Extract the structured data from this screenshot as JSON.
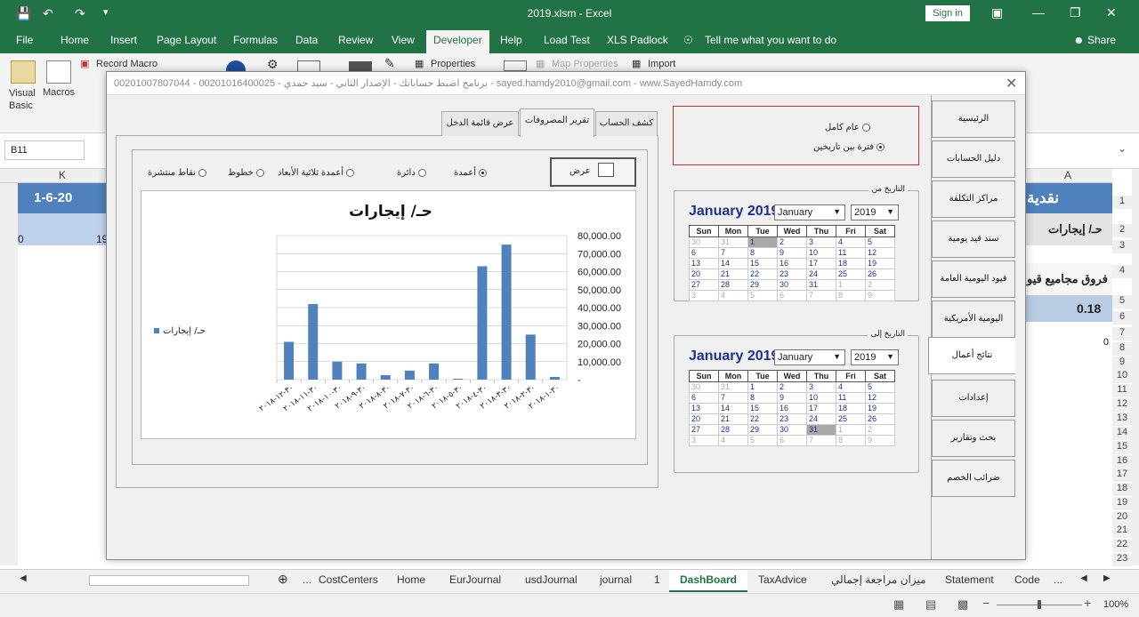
{
  "window": {
    "title": "2019.xlsm  -  Excel",
    "sign_in": "Sign in"
  },
  "ribbon_tabs": [
    "File",
    "Home",
    "Insert",
    "Page Layout",
    "Formulas",
    "Data",
    "Review",
    "View",
    "Developer",
    "Help",
    "Load Test",
    "XLS Padlock",
    "Tell me what you want to do",
    "Share"
  ],
  "ribbon": {
    "visual_basic": "Visual Basic",
    "macros": "Macros",
    "record_macro": "Record Macro",
    "properties": "Properties",
    "map_properties": "Map Properties",
    "import": "Import"
  },
  "namebox": "B11",
  "sheet": {
    "col_k": "K",
    "col_a": "A",
    "k_row1": "1-6-20",
    "k_row2": "19",
    "left_row2": "0",
    "a_row1": "نقدية",
    "a_row2": "حـ/ إيجارات",
    "a_row4": "فروق مجاميع قيو",
    "a_row5": "0.18",
    "a_row7": "0",
    "rows": [
      "1",
      "2",
      "3",
      "4",
      "5",
      "6",
      "7",
      "8",
      "9",
      "10",
      "11",
      "12",
      "13",
      "14",
      "15",
      "16",
      "17",
      "18",
      "19",
      "20",
      "21",
      "22",
      "23"
    ]
  },
  "sheet_tabs": [
    "...",
    "CostCenters",
    "Home",
    "EurJournal",
    "usdJournal",
    "journal",
    "1",
    "DashBoard",
    "TaxAdvice",
    "ميزان مراجعة إجمالي",
    "Statement",
    "Code",
    "..."
  ],
  "status": {
    "zoom": "100%"
  },
  "dialog": {
    "title": "برنامج اضبط حساباتك - الإصدار الثاني - سيد حمدي - 00201016400025 - 00201007807044 - sayed.hamdy2010@gmail.com - www.SayedHamdy.com",
    "nav": [
      "الرئيسية",
      "دليل الحسابات",
      "مراكز التكلفة",
      "سند قيد يومية",
      "قيود اليومية العامة",
      "اليومية الأمريكية",
      "نتائج أعمال",
      "إعدادات",
      "بحث وتقارير",
      "ضرائب الخصم"
    ],
    "inner_tabs": [
      "كشف الحساب",
      "تقرير المصروفات",
      "عرض قائمة الدخل"
    ],
    "chart_types": [
      "أعمدة",
      "دائرة",
      "أعمدة ثلاثية الأبعاد",
      "خطوط",
      "نقاط منتشرة"
    ],
    "show_button": "عرض",
    "period_options": [
      "عام كامل",
      "فترة بين تاريخين"
    ],
    "from_label": "التاريخ من",
    "to_label": "التاريخ إلى",
    "cal_from": {
      "header": "January 2019",
      "month": "January",
      "year": "2019"
    },
    "cal_to": {
      "header": "January 2019",
      "month": "January",
      "year": "2019"
    },
    "weekdays": [
      "Sun",
      "Mon",
      "Tue",
      "Wed",
      "Thu",
      "Fri",
      "Sat"
    ]
  },
  "chart_data": {
    "type": "bar",
    "title": "حـ/ إيجارات",
    "series": [
      {
        "name": "حـ/ إيجارات",
        "values": [
          21000,
          42000,
          10000,
          9000,
          2500,
          5000,
          9000,
          500,
          63000,
          75000,
          25000,
          1500
        ]
      }
    ],
    "categories": [
      "٣٠-١٢-٢٠١٨",
      "٣٠-١١-٢٠١٨",
      "٣٠-١٠-٢٠١٨",
      "٣٠-٩-٢٠١٨",
      "٣٠-٨-٢٠١٨",
      "٣٠-٧-٢٠١٨",
      "٣٠-٦-٢٠١٨",
      "٣٠-٥-٢٠١٨",
      "٣٠-٤-٢٠١٨",
      "٣٠-٣-٢٠١٨",
      "٣٠-٢-٢٠١٨",
      "٣٠-١-٢٠١٨"
    ],
    "y_ticks": [
      "80,000.00",
      "70,000.00",
      "60,000.00",
      "50,000.00",
      "40,000.00",
      "30,000.00",
      "20,000.00",
      "10,000.00",
      "-"
    ],
    "ylim": [
      0,
      80000
    ],
    "legend": "left",
    "colors": {
      "bar": "#4f81bd"
    },
    "grid": true
  }
}
